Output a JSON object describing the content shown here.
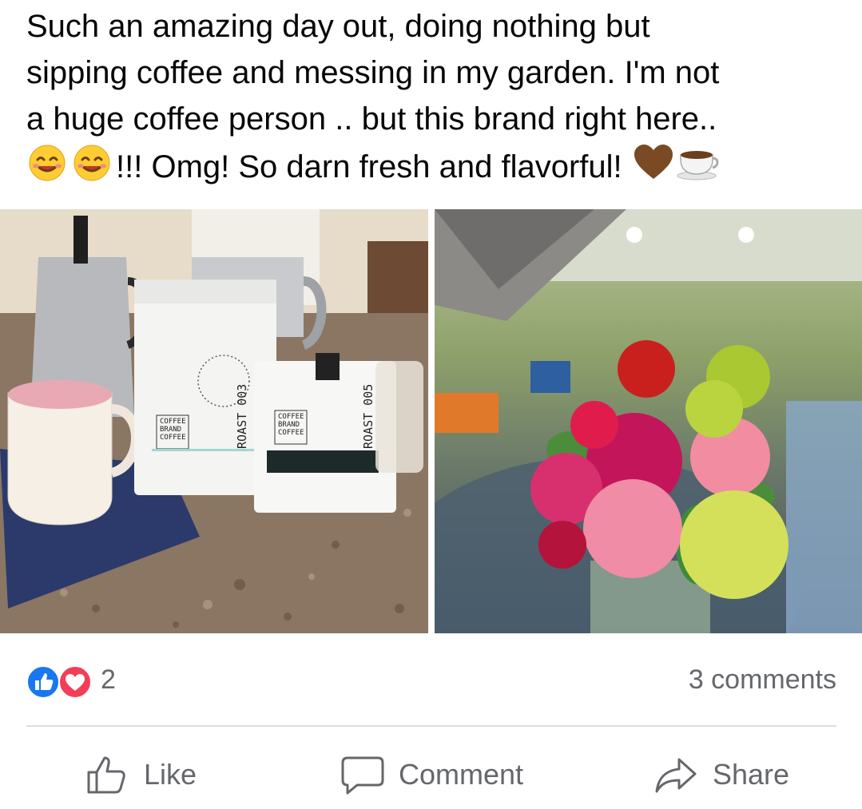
{
  "post": {
    "text_lines": [
      "Such an amazing day out, doing nothing but",
      "sipping coffee and messing in my garden. I'm not",
      "a huge coffee person .. but this brand right here..",
      "!!! Omg! So darn fresh and flavorful!"
    ],
    "emoji_before_last_line": [
      "smiling-face-icon",
      "smiling-face-icon"
    ],
    "emoji_after_last_line": [
      "brown-heart-icon",
      "coffee-cup-icon"
    ]
  },
  "photos": {
    "left": {
      "subject": "coffee-bags-on-counter",
      "bag1_brand": "COFFEE BRAND COFFEE",
      "bag1_roast": "ROAST 003",
      "bag2_brand": "COFFEE BRAND COFFEE",
      "bag2_roast": "ROAST 005"
    },
    "right": {
      "subject": "flower-bouquet"
    }
  },
  "reactions": {
    "icons": [
      "like-icon",
      "love-icon"
    ],
    "count": "2",
    "comments": "3 comments"
  },
  "actions": {
    "like": "Like",
    "comment": "Comment",
    "share": "Share"
  },
  "colors": {
    "like_blue": "#1877f2",
    "love_red": "#f33e58",
    "secondary_text": "#65676b",
    "divider": "#dadde1"
  }
}
